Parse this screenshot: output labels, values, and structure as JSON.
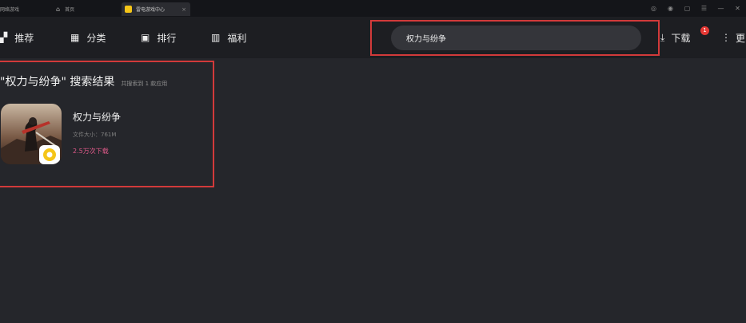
{
  "tabs": [
    {
      "label": "网络游戏",
      "icon": "none"
    },
    {
      "label": "首页",
      "icon": "home-icon"
    },
    {
      "label": "雷电游戏中心",
      "icon": "app-logo-icon",
      "close": "×"
    }
  ],
  "window_controls": [
    "◎",
    "◉",
    "▢",
    "☰",
    "—",
    "✕"
  ],
  "nav": {
    "items": [
      {
        "label": "推荐",
        "icon": "thumbs-up-icon",
        "glyph": "▞"
      },
      {
        "label": "分类",
        "icon": "grid-icon",
        "glyph": "▦"
      },
      {
        "label": "排行",
        "icon": "ranking-icon",
        "glyph": "▣"
      },
      {
        "label": "福利",
        "icon": "gift-icon",
        "glyph": "▥"
      }
    ],
    "search_value": "权力与纷争",
    "download_label": "下载",
    "download_glyph": "⤓",
    "download_badge": "1",
    "more_label": "更多",
    "more_glyph": "⋮"
  },
  "results": {
    "title": "\"权力与纷争\" 搜索结果",
    "count_text": "共搜索到 1 款应用",
    "apps": [
      {
        "name": "权力与纷争",
        "size": "文件大小：761M",
        "downloads": "2.5万次下载"
      }
    ]
  },
  "colors": {
    "background": "#25262b",
    "navbar": "#1d1e22",
    "highlight": "#d23a3a",
    "downloads_accent": "#e05a8a",
    "badge": "#e53935"
  }
}
